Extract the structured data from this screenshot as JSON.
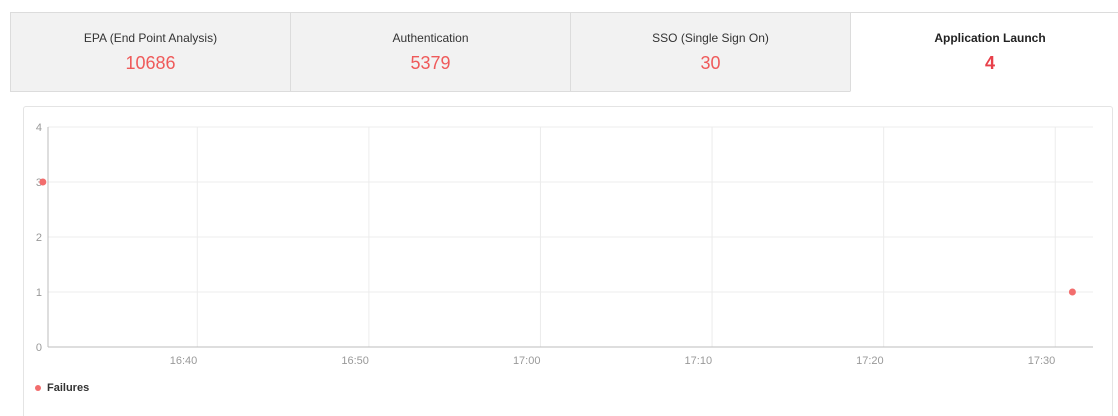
{
  "tabs": [
    {
      "label": "EPA (End Point Analysis)",
      "count": "10686"
    },
    {
      "label": "Authentication",
      "count": "5379"
    },
    {
      "label": "SSO (Single Sign On)",
      "count": "30"
    },
    {
      "label": "Application Launch",
      "count": "4",
      "active": true
    }
  ],
  "legend": {
    "label": "Failures"
  },
  "colors": {
    "accent": "#f26d6d",
    "count": "#ef5a5a",
    "active_count": "#e8404a"
  },
  "chart_data": {
    "type": "scatter",
    "x_ticks": [
      "16:40",
      "16:50",
      "17:00",
      "17:10",
      "17:20",
      "17:30"
    ],
    "y_ticks": [
      "0",
      "1",
      "2",
      "3",
      "4"
    ],
    "ylim": [
      0,
      4
    ],
    "xlim": [
      "16:31",
      "17:31"
    ],
    "grid": true,
    "legend_position": "bottom-left",
    "series": [
      {
        "name": "Failures",
        "color": "#f26d6d",
        "points": [
          {
            "x": "16:31",
            "y": 3
          },
          {
            "x": "17:31",
            "y": 1
          }
        ]
      }
    ]
  }
}
